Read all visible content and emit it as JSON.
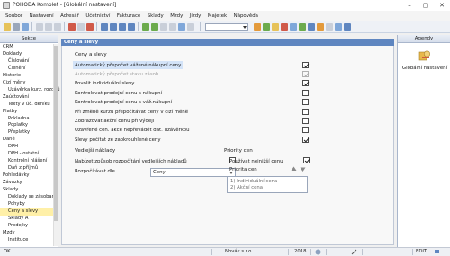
{
  "window": {
    "title": "POHODA Komplet - [Globální nastavení]"
  },
  "menu": [
    "Soubor",
    "Nastavení",
    "Adresář",
    "Účetnictví",
    "Fakturace",
    "Sklady",
    "Mzdy",
    "Jízdy",
    "Majetek",
    "Nápověda"
  ],
  "sidebar": {
    "header": "Sekce",
    "items": [
      {
        "label": "CRM",
        "indent": 0
      },
      {
        "label": "Doklady",
        "indent": 0
      },
      {
        "label": "Číslování",
        "indent": 1
      },
      {
        "label": "Členění",
        "indent": 1
      },
      {
        "label": "Historie",
        "indent": 0
      },
      {
        "label": "Cizí měny",
        "indent": 0
      },
      {
        "label": "Uzávěrka kurz. rozdílů",
        "indent": 1
      },
      {
        "label": "Zaúčtování",
        "indent": 0
      },
      {
        "label": "Texty v úč. deníku",
        "indent": 1
      },
      {
        "label": "Platby",
        "indent": 0
      },
      {
        "label": "Pokladna",
        "indent": 1
      },
      {
        "label": "Poplatky",
        "indent": 1
      },
      {
        "label": "Přeplatky",
        "indent": 1
      },
      {
        "label": "Daně",
        "indent": 0
      },
      {
        "label": "DPH",
        "indent": 1
      },
      {
        "label": "DPH - ostatní",
        "indent": 1
      },
      {
        "label": "Kontrolní hlášení",
        "indent": 1
      },
      {
        "label": "Daň z příjmů",
        "indent": 1
      },
      {
        "label": "Pohledávky",
        "indent": 0
      },
      {
        "label": "Závazky",
        "indent": 0
      },
      {
        "label": "Sklady",
        "indent": 0
      },
      {
        "label": "Doklady se zásobami",
        "indent": 1
      },
      {
        "label": "Pohyby",
        "indent": 1
      },
      {
        "label": "Ceny a slevy",
        "indent": 1,
        "selected": true
      },
      {
        "label": "Sklady A",
        "indent": 1
      },
      {
        "label": "Prodejky",
        "indent": 1
      },
      {
        "label": "Mzdy",
        "indent": 0
      },
      {
        "label": "Instituce",
        "indent": 1
      }
    ]
  },
  "main": {
    "header": "Ceny a slevy",
    "section_title": "Ceny a slevy",
    "options": [
      {
        "label": "Automatický přepočet vážené nákupní ceny",
        "checked": true,
        "disabled": false,
        "highlight": true
      },
      {
        "label": "Automatický přepočet stavu zásob",
        "checked": true,
        "disabled": true,
        "highlight": false
      },
      {
        "label": "Povolit individuální slevy",
        "checked": true,
        "disabled": false,
        "highlight": false
      },
      {
        "label": "Kontrolovat prodejní cenu s nákupní",
        "checked": false,
        "disabled": false,
        "highlight": false
      },
      {
        "label": "Kontrolovat prodejní cenu s váž.nákupní",
        "checked": false,
        "disabled": false,
        "highlight": false
      },
      {
        "label": "Při změně kurzu přepočítávat ceny v cizí měně",
        "checked": false,
        "disabled": false,
        "highlight": false
      },
      {
        "label": "Zobrazovat akční cenu při výdeji",
        "checked": false,
        "disabled": false,
        "highlight": false
      },
      {
        "label": "Uzavřené cen. akce nepřevádět dat. uzávěrkou",
        "checked": false,
        "disabled": false,
        "highlight": false
      },
      {
        "label": "Slevy počítat ze zaokrouhlené ceny",
        "checked": true,
        "disabled": false,
        "highlight": false
      }
    ],
    "side_costs": {
      "title": "Vedlejší náklady",
      "offer_label": "Nabízet způsob rozpočítání vedlejších nákladů",
      "offer_checked": false,
      "distribute_label": "Rozpočítávat dle",
      "distribute_value": "Ceny"
    },
    "price_priority": {
      "title": "Priority cen",
      "use_lowest_label": "Používat nejnižší cenu",
      "use_lowest_checked": true,
      "priority_label": "Priorita cen",
      "list": [
        "1) Individuální cena",
        "2) Akční cena"
      ]
    }
  },
  "agenda": {
    "header": "Agendy",
    "item_label": "Globální nastavení"
  },
  "status": {
    "left": "OK",
    "company": "Novák s.r.o.",
    "year": "2018",
    "mode": "EDIT"
  },
  "colors": {
    "accent": "#5f86c0",
    "selected_nav": "#fff0a8",
    "highlight_row": "#d3e3f8"
  }
}
